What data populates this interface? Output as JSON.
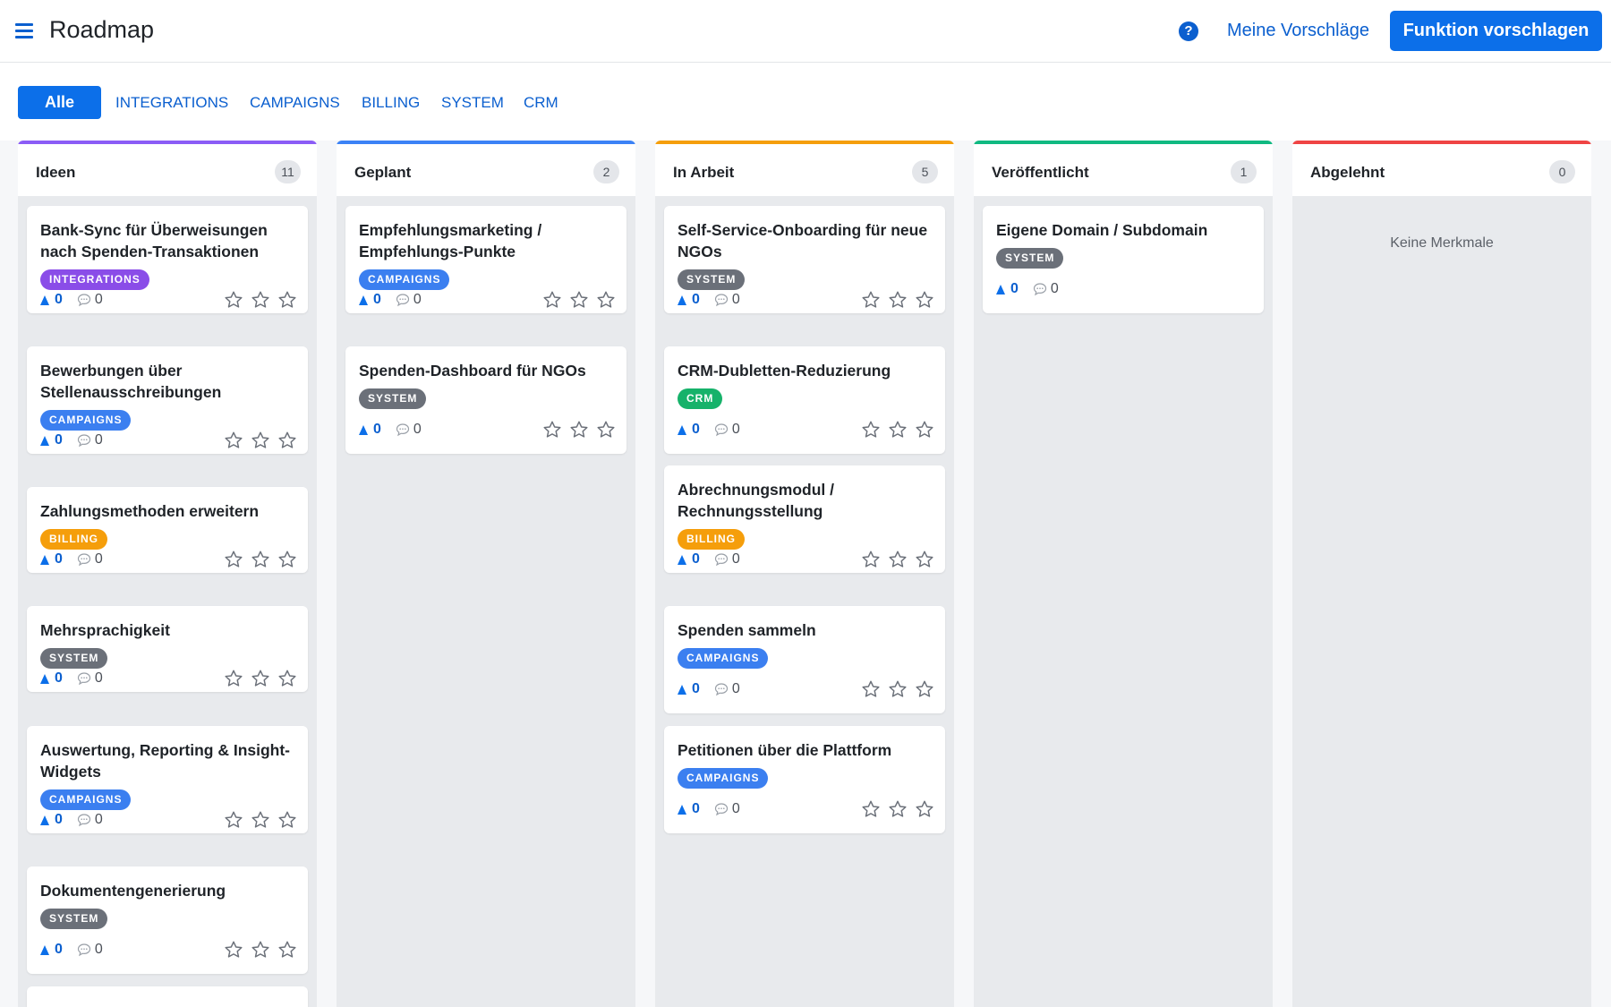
{
  "header": {
    "title": "Roadmap",
    "menu_icon": "hamburger-menu-icon",
    "help_icon": "question-circle-icon",
    "help_symbol": "?",
    "my_suggestions": "Meine Vorschläge",
    "suggest_button": "Funktion vorschlagen"
  },
  "filters": {
    "active": "Alle",
    "tabs": [
      "INTEGRATIONS",
      "CAMPAIGNS",
      "BILLING",
      "SYSTEM",
      "CRM"
    ]
  },
  "colors": {
    "primary": "#0c6fe9",
    "integrations": "#8a4de8",
    "campaigns": "#3b7ff0",
    "billing": "#f59e0b",
    "system": "#6b7079",
    "crm": "#16b26a",
    "col_ideen": "#8b5cf6",
    "col_geplant": "#3b82f6",
    "col_in_arbeit": "#f59e0b",
    "col_veroeffentlicht": "#10b981",
    "col_abgelehnt": "#ef4444"
  },
  "columns": [
    {
      "title": "Ideen",
      "count": "11",
      "cards": [
        {
          "title": "Bank-Sync für Überweisungen nach Spenden-Transaktionen",
          "tag": "INTEGRATIONS",
          "votes": "0",
          "comments": "0"
        },
        {
          "title": "Bewerbungen über Stellenausschreibungen",
          "tag": "CAMPAIGNS",
          "votes": "0",
          "comments": "0"
        },
        {
          "title": "Zahlungsmethoden erweitern",
          "tag": "BILLING",
          "votes": "0",
          "comments": "0"
        },
        {
          "title": "Mehrsprachigkeit",
          "tag": "SYSTEM",
          "votes": "0",
          "comments": "0"
        },
        {
          "title": "Auswertung, Reporting & Insight-Widgets",
          "tag": "CAMPAIGNS",
          "votes": "0",
          "comments": "0"
        },
        {
          "title": "Dokumentengenerierung",
          "tag": "SYSTEM",
          "votes": "0",
          "comments": "0"
        }
      ]
    },
    {
      "title": "Geplant",
      "count": "2",
      "cards": [
        {
          "title": "Empfehlungsmarketing / Empfehlungs-Punkte",
          "tag": "CAMPAIGNS",
          "votes": "0",
          "comments": "0"
        },
        {
          "title": "Spenden-Dashboard für NGOs",
          "tag": "SYSTEM",
          "votes": "0",
          "comments": "0"
        }
      ]
    },
    {
      "title": "In Arbeit",
      "count": "5",
      "cards": [
        {
          "title": "Self-Service-Onboarding für neue NGOs",
          "tag": "SYSTEM",
          "votes": "0",
          "comments": "0"
        },
        {
          "title": "CRM-Dubletten-Reduzierung",
          "tag": "CRM",
          "votes": "0",
          "comments": "0"
        },
        {
          "title": "Abrechnungsmodul / Rechnungsstellung",
          "tag": "BILLING",
          "votes": "0",
          "comments": "0"
        },
        {
          "title": "Spenden sammeln",
          "tag": "CAMPAIGNS",
          "votes": "0",
          "comments": "0"
        },
        {
          "title": "Petitionen über die Plattform",
          "tag": "CAMPAIGNS",
          "votes": "0",
          "comments": "0"
        }
      ]
    },
    {
      "title": "Veröffentlicht",
      "count": "1",
      "cards": [
        {
          "title": "Eigene Domain / Subdomain",
          "tag": "SYSTEM",
          "votes": "0",
          "comments": "0"
        }
      ]
    },
    {
      "title": "Abgelehnt",
      "count": "0",
      "empty_text": "Keine Merkmale",
      "cards": []
    }
  ]
}
